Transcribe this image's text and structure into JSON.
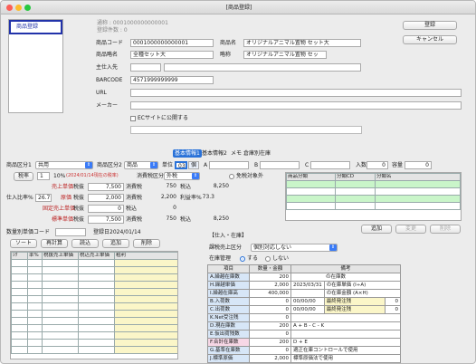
{
  "window": {
    "title": "[商品登録]"
  },
  "meta": {
    "created": "通称 : 0001000000000001",
    "reg_count": "登録件数 : 0"
  },
  "sidebar": {
    "selected": "商品登録"
  },
  "actions": {
    "register": "登録",
    "cancel": "キャンセル"
  },
  "form": {
    "code_label": "商品コード",
    "code_value": "0001000000000001",
    "name_label": "商品名",
    "name_value": "オリジナルアニマル置物 セット大",
    "short_label": "商品略名",
    "short_value": "全種セット大",
    "alias_label": "略称",
    "alias_value": "オリジナルアニマル置物 セッ",
    "supplier_label": "主仕入先",
    "barcode_label": "BARCODE",
    "barcode_value": "4571999999999",
    "url_label": "URL",
    "maker_label": "メーカー",
    "ec_label": "ECサイトに公開する"
  },
  "tabs": [
    "基本情報1",
    "基本情報2",
    "メモ",
    "倉庫別在庫"
  ],
  "basic": {
    "cat1_label": "商品区分1",
    "cat1_value": "共用",
    "cat2_label": "商品区分2",
    "cat2_value": "商品",
    "unit_label": "単位",
    "unit_value": "03",
    "unit_name": "個",
    "a_label": "A",
    "b_label": "B",
    "c_label": "C",
    "inbox_label": "入数",
    "inbox_value": "0",
    "capacity_label": "容量",
    "capacity_value": "0",
    "tax_rate_btn": "税率",
    "tax_rate_value": "1",
    "tax_rate_pct": "10%",
    "tax_note": "(2024/01/14現在の税率)",
    "tax_class_label": "消費税区分",
    "tax_class_value": "外税",
    "tax_free_label": "免税対象外",
    "price_rows": [
      {
        "label": "売上単価",
        "tax": "税抜",
        "value": "7,500",
        "tax_word": "消費税",
        "tax_value": "750",
        "tax_inc": "税込",
        "inc_value": "8,250",
        "extra": ""
      },
      {
        "label": "原価",
        "tax": "税抜",
        "value": "2,000",
        "tax_word": "消費税",
        "tax_value": "2,200",
        "tax_inc": "利益率%",
        "inc_value": "73.3",
        "extra": ""
      },
      {
        "label": "固定売上単価",
        "tax": "税抜",
        "value": "0",
        "tax_word": "税込",
        "tax_value": "0",
        "tax_inc": "",
        "inc_value": "",
        "extra": ""
      },
      {
        "label": "標準単価",
        "tax": "税抜",
        "value": "7,500",
        "tax_word": "消費税",
        "tax_value": "750",
        "tax_inc": "税込",
        "inc_value": "8,250",
        "extra": ""
      }
    ],
    "purchase_rate_label": "仕入比率%",
    "purchase_rate_value": "26.7",
    "qty_code_label": "数量別単価コード",
    "reg_date_label": "登録日",
    "reg_date_value": "2024/01/14"
  },
  "classes": {
    "headers": [
      "商品分類",
      "分類CD",
      "分類名"
    ]
  },
  "class_buttons": {
    "add": "追加",
    "edit": "変更",
    "delete": "削除"
  },
  "qty_buttons": [
    "ソート",
    "再計算",
    "読込",
    "追加",
    "削除"
  ],
  "qty_table": {
    "headers": [
      "ｼｸ",
      "率%",
      "税抜売上単価",
      "税込売上単価",
      "粗利"
    ]
  },
  "stock": {
    "section": "【仕入・在庫】",
    "sales_kind_label": "課税売上区分",
    "sales_kind_value": "個別対応しない",
    "manage_label": "在庫管理",
    "manage_yes": "する",
    "manage_no": "しない",
    "headers": [
      "項目",
      "数量・金額",
      "備考"
    ],
    "rows": [
      {
        "item": "A.繰越在庫数",
        "value": "200",
        "note": "の在庫数",
        "extra_label": "",
        "extra_value": ""
      },
      {
        "item": "H.繰越単価",
        "value": "2,000",
        "note": "2023/03/31",
        "extra_label": "の在庫単価 (I÷A)",
        "extra_value": ""
      },
      {
        "item": "I.繰越在庫高",
        "value": "400,000",
        "note": "",
        "extra_label": "の在庫金額 (A×H)",
        "extra_value": ""
      },
      {
        "item": "B.入荷数",
        "value": "0",
        "note": "00/00/00",
        "extra_label": "最終発注残",
        "extra_value": "0"
      },
      {
        "item": "C.出荷数",
        "value": "0",
        "note": "00/00/00",
        "extra_label": "最終発注残",
        "extra_value": "0"
      },
      {
        "item": "K.Net受注残",
        "value": "0",
        "note": "",
        "extra_label": "",
        "extra_value": ""
      },
      {
        "item": "D.現在庫数",
        "value": "200",
        "note": "A + B - C - K",
        "extra_label": "",
        "extra_value": ""
      },
      {
        "item": "E.仮出荷残数",
        "value": "0",
        "note": "",
        "extra_label": "",
        "extra_value": ""
      },
      {
        "item": "F.合計在庫数",
        "value": "200",
        "note": "D + E",
        "extra_label": "",
        "extra_value": ""
      },
      {
        "item": "G.基準在庫数",
        "value": "0",
        "note": "適正在庫コントロールで使用",
        "extra_label": "",
        "extra_value": ""
      },
      {
        "item": "J.標準原価",
        "value": "2,000",
        "note": "標準原価法で使用",
        "extra_label": "",
        "extra_value": ""
      }
    ]
  }
}
